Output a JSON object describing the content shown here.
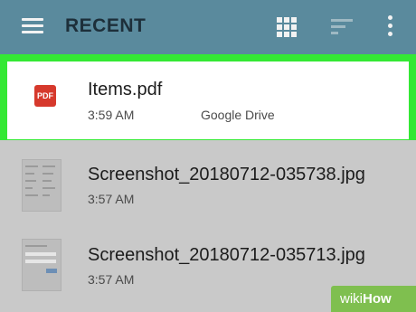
{
  "header": {
    "title": "RECENT",
    "menu_icon": "hamburger-menu-icon",
    "grid_icon": "grid-view-icon",
    "sort_icon": "sort-icon",
    "more_icon": "more-vertical-icon",
    "bar_color": "#5a8a9d"
  },
  "files": [
    {
      "name": "Items.pdf",
      "time": "3:59 AM",
      "source": "Google Drive",
      "icon": "pdf-icon",
      "selected": true
    },
    {
      "name": "Screenshot_20180712-035738.jpg",
      "time": "3:57 AM",
      "icon": "image-thumbnail"
    },
    {
      "name": "Screenshot_20180712-035713.jpg",
      "time": "3:57 AM",
      "icon": "image-thumbnail"
    }
  ],
  "pdf_badge": "PDF",
  "highlight_color": "#34e834",
  "watermark": {
    "part1": "wiki",
    "part2": "How"
  }
}
